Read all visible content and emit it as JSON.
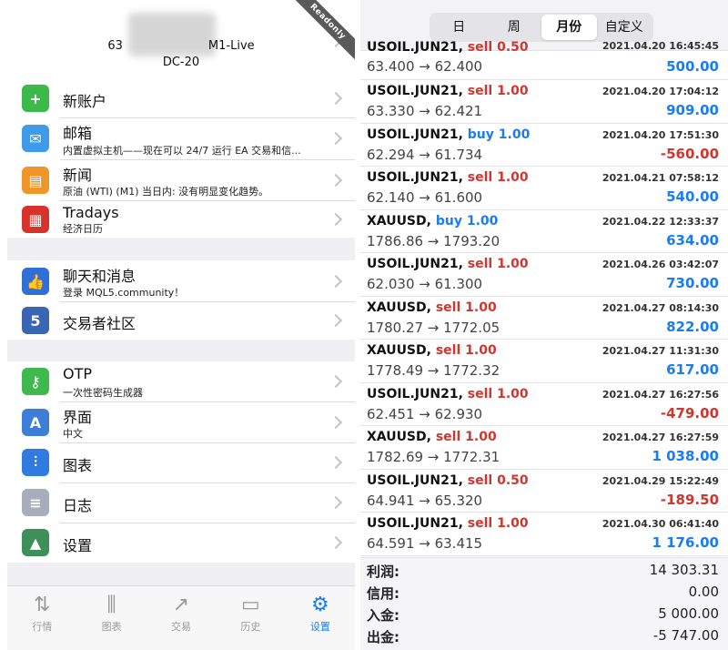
{
  "account": {
    "line1_prefix": "63",
    "line1_suffix": "M1-Live",
    "line2": "DC-20",
    "ribbon": "Readonly"
  },
  "menu_groups": [
    [
      {
        "title": "新账户",
        "subtitle": "",
        "icon": "add-account-icon",
        "color": "#3bb94a",
        "glyph": "+"
      },
      {
        "title": "邮箱",
        "subtitle": "内置虚拟主机——现在可以 24/7 运行 EA 交易和信...",
        "icon": "mail-icon",
        "color": "#3d9bea",
        "glyph": "✉"
      },
      {
        "title": "新闻",
        "subtitle": "原油 (WTI) (M1) 当日内: 没有明显变化趋势。",
        "icon": "news-book-icon",
        "color": "#f0952a",
        "glyph": "▤"
      },
      {
        "title": "Tradays",
        "subtitle": "经济日历",
        "icon": "calendar-icon",
        "color": "#d8332b",
        "glyph": "▦"
      }
    ],
    [
      {
        "title": "聊天和消息",
        "subtitle": "登录 MQL5.community！",
        "icon": "chat-thumb-icon",
        "color": "#2f6fd6",
        "glyph": "👍"
      },
      {
        "title": "交易者社区",
        "subtitle": "",
        "icon": "mql5-icon",
        "color": "#3a64b4",
        "glyph": "5"
      }
    ],
    [
      {
        "title": "OTP",
        "subtitle": "一次性密码生成器",
        "icon": "otp-key-icon",
        "color": "#3fb84e",
        "glyph": "⚷"
      },
      {
        "title": "界面",
        "subtitle": "中文",
        "icon": "language-icon",
        "color": "#3d7fd8",
        "glyph": "A"
      },
      {
        "title": "图表",
        "subtitle": "",
        "icon": "chart-candles-icon",
        "color": "#2f7be0",
        "glyph": "⫶"
      },
      {
        "title": "日志",
        "subtitle": "",
        "icon": "journal-icon",
        "color": "#a7adbb",
        "glyph": "≡"
      },
      {
        "title": "设置",
        "subtitle": "",
        "icon": "settings-app-icon",
        "color": "#3f8f5a",
        "glyph": "▲"
      }
    ]
  ],
  "tabs": [
    {
      "label": "行情",
      "icon": "quotes-icon",
      "glyph": "⇅",
      "active": false
    },
    {
      "label": "图表",
      "icon": "chart-icon",
      "glyph": "⫼",
      "active": false
    },
    {
      "label": "交易",
      "icon": "trade-icon",
      "glyph": "↗",
      "active": false
    },
    {
      "label": "历史",
      "icon": "history-inbox-icon",
      "glyph": "▭",
      "active": false
    },
    {
      "label": "设置",
      "icon": "gear-icon",
      "glyph": "⚙",
      "active": true
    }
  ],
  "period_tabs": [
    {
      "label": "日",
      "active": false
    },
    {
      "label": "周",
      "active": false
    },
    {
      "label": "月份",
      "active": true
    },
    {
      "label": "自定义",
      "active": false
    }
  ],
  "trades": [
    {
      "symbol": "USOIL.JUN21,",
      "side": "sell",
      "volume": "0.50",
      "time": "2021.04.20 16:45:45",
      "price": "63.400 → 62.400",
      "profit": "500.00",
      "partial": true
    },
    {
      "symbol": "USOIL.JUN21,",
      "side": "sell",
      "volume": "1.00",
      "time": "2021.04.20 17:04:12",
      "price": "63.330 → 62.421",
      "profit": "909.00"
    },
    {
      "symbol": "USOIL.JUN21,",
      "side": "buy",
      "volume": "1.00",
      "time": "2021.04.20 17:51:30",
      "price": "62.294 → 61.734",
      "profit": "-560.00"
    },
    {
      "symbol": "USOIL.JUN21,",
      "side": "sell",
      "volume": "1.00",
      "time": "2021.04.21 07:58:12",
      "price": "62.140 → 61.600",
      "profit": "540.00"
    },
    {
      "symbol": "XAUUSD,",
      "side": "buy",
      "volume": "1.00",
      "time": "2021.04.22 12:33:37",
      "price": "1786.86 → 1793.20",
      "profit": "634.00"
    },
    {
      "symbol": "USOIL.JUN21,",
      "side": "sell",
      "volume": "1.00",
      "time": "2021.04.26 03:42:07",
      "price": "62.030 → 61.300",
      "profit": "730.00"
    },
    {
      "symbol": "XAUUSD,",
      "side": "sell",
      "volume": "1.00",
      "time": "2021.04.27 08:14:30",
      "price": "1780.27 → 1772.05",
      "profit": "822.00"
    },
    {
      "symbol": "XAUUSD,",
      "side": "sell",
      "volume": "1.00",
      "time": "2021.04.27 11:31:30",
      "price": "1778.49 → 1772.32",
      "profit": "617.00"
    },
    {
      "symbol": "USOIL.JUN21,",
      "side": "sell",
      "volume": "1.00",
      "time": "2021.04.27 16:27:56",
      "price": "62.451 → 62.930",
      "profit": "-479.00"
    },
    {
      "symbol": "XAUUSD,",
      "side": "sell",
      "volume": "1.00",
      "time": "2021.04.27 16:27:59",
      "price": "1782.69 → 1772.31",
      "profit": "1 038.00"
    },
    {
      "symbol": "USOIL.JUN21,",
      "side": "sell",
      "volume": "0.50",
      "time": "2021.04.29 15:22:49",
      "price": "64.941 → 65.320",
      "profit": "-189.50"
    },
    {
      "symbol": "USOIL.JUN21,",
      "side": "sell",
      "volume": "1.00",
      "time": "2021.04.30 06:41:40",
      "price": "64.591 → 63.415",
      "profit": "1 176.00"
    }
  ],
  "summary": [
    {
      "label": "利润:",
      "value": "14 303.31"
    },
    {
      "label": "信用:",
      "value": "0.00"
    },
    {
      "label": "入金:",
      "value": "5 000.00"
    },
    {
      "label": "出金:",
      "value": "-5 747.00"
    }
  ]
}
